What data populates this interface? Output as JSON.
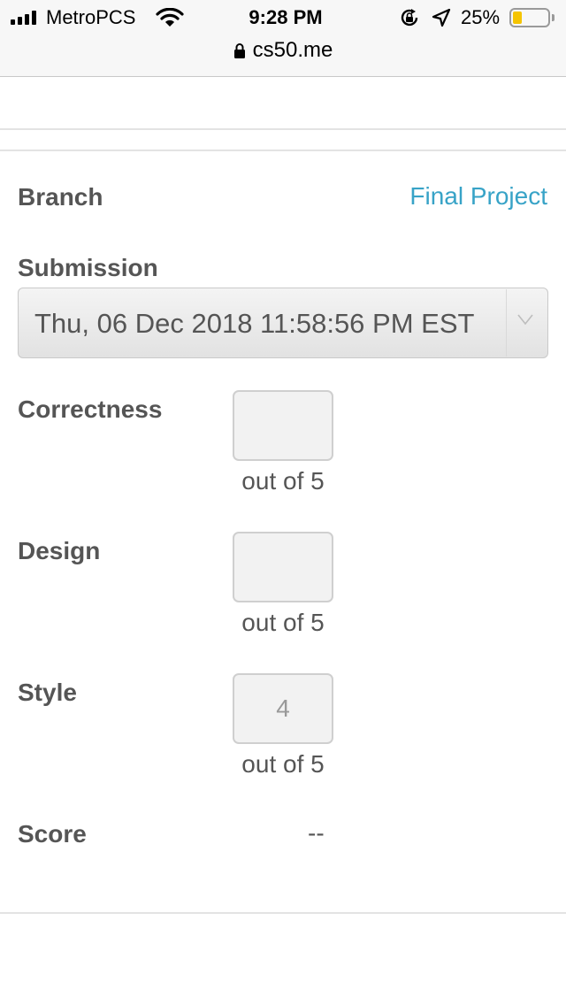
{
  "status_bar": {
    "carrier": "MetroPCS",
    "time": "9:28 PM",
    "battery_percent": "25%",
    "battery_level": 0.25,
    "battery_color": "#f5c400",
    "icons": [
      "signal-icon",
      "wifi-icon",
      "rotation-lock-icon",
      "location-arrow-icon",
      "battery-icon"
    ]
  },
  "url_bar": {
    "domain": "cs50.me",
    "icon": "lock-icon"
  },
  "form": {
    "branch": {
      "label": "Branch",
      "value": "Final Project",
      "link_color": "#38a3c7"
    },
    "submission": {
      "label": "Submission",
      "selected": "Thu, 06 Dec 2018 11:58:56 PM EST",
      "icon": "chevron-down-icon"
    },
    "correctness": {
      "label": "Correctness",
      "value": "",
      "suffix": "out of 5"
    },
    "design": {
      "label": "Design",
      "value": "",
      "suffix": "out of 5"
    },
    "style": {
      "label": "Style",
      "value": "",
      "placeholder": "4",
      "suffix": "out of 5"
    },
    "score": {
      "label": "Score",
      "value": "--"
    }
  }
}
